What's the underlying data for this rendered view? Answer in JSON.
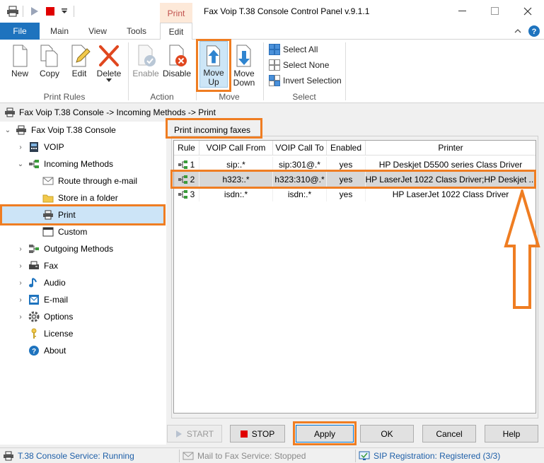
{
  "window": {
    "title": "Fax Voip T.38 Console Control Panel v.9.1.1",
    "context_tab": "Print"
  },
  "tabs": [
    "File",
    "Main",
    "View",
    "Tools",
    "Edit"
  ],
  "ribbon": {
    "print_rules": {
      "label": "Print Rules",
      "new": "New",
      "copy": "Copy",
      "edit": "Edit",
      "delete": "Delete"
    },
    "action": {
      "label": "Action",
      "enable": "Enable",
      "disable": "Disable"
    },
    "move": {
      "label": "Move",
      "up_line1": "Move",
      "up_line2": "Up",
      "down_line1": "Move",
      "down_line2": "Down"
    },
    "select": {
      "label": "Select",
      "all": "Select All",
      "none": "Select None",
      "invert": "Invert Selection"
    }
  },
  "breadcrumb": "Fax Voip T.38 Console -> Incoming Methods -> Print",
  "tree": {
    "root": "Fax Voip T.38 Console",
    "voip": "VOIP",
    "incoming": "Incoming Methods",
    "route_email": "Route through e-mail",
    "store_folder": "Store in a folder",
    "print": "Print",
    "custom": "Custom",
    "outgoing": "Outgoing Methods",
    "fax": "Fax",
    "audio": "Audio",
    "email": "E-mail",
    "options": "Options",
    "license": "License",
    "about": "About"
  },
  "panel_title": "Print incoming faxes",
  "table": {
    "headers": [
      "Rule",
      "VOIP Call From",
      "VOIP Call To",
      "Enabled",
      "Printer"
    ],
    "rows": [
      [
        "1",
        "sip:.*",
        "sip:301@.*",
        "yes",
        "HP Deskjet D5500 series Class Driver"
      ],
      [
        "2",
        "h323:.*",
        "h323:310@.*",
        "yes",
        "HP LaserJet 1022 Class Driver;HP Deskjet ..."
      ],
      [
        "3",
        "isdn:.*",
        "isdn:.*",
        "yes",
        "HP LaserJet 1022 Class Driver"
      ]
    ],
    "selected_row": 2
  },
  "buttons": {
    "start": "START",
    "stop": "STOP",
    "apply": "Apply",
    "ok": "OK",
    "cancel": "Cancel",
    "help": "Help"
  },
  "status": {
    "t38": "T.38 Console Service: Running",
    "mail": "Mail to Fax Service: Stopped",
    "sip": "SIP Registration: Registered (3/3)"
  },
  "colors": {
    "accent": "#1e73be",
    "highlight": "#ef7d22",
    "context_tab": "#c0504d"
  }
}
